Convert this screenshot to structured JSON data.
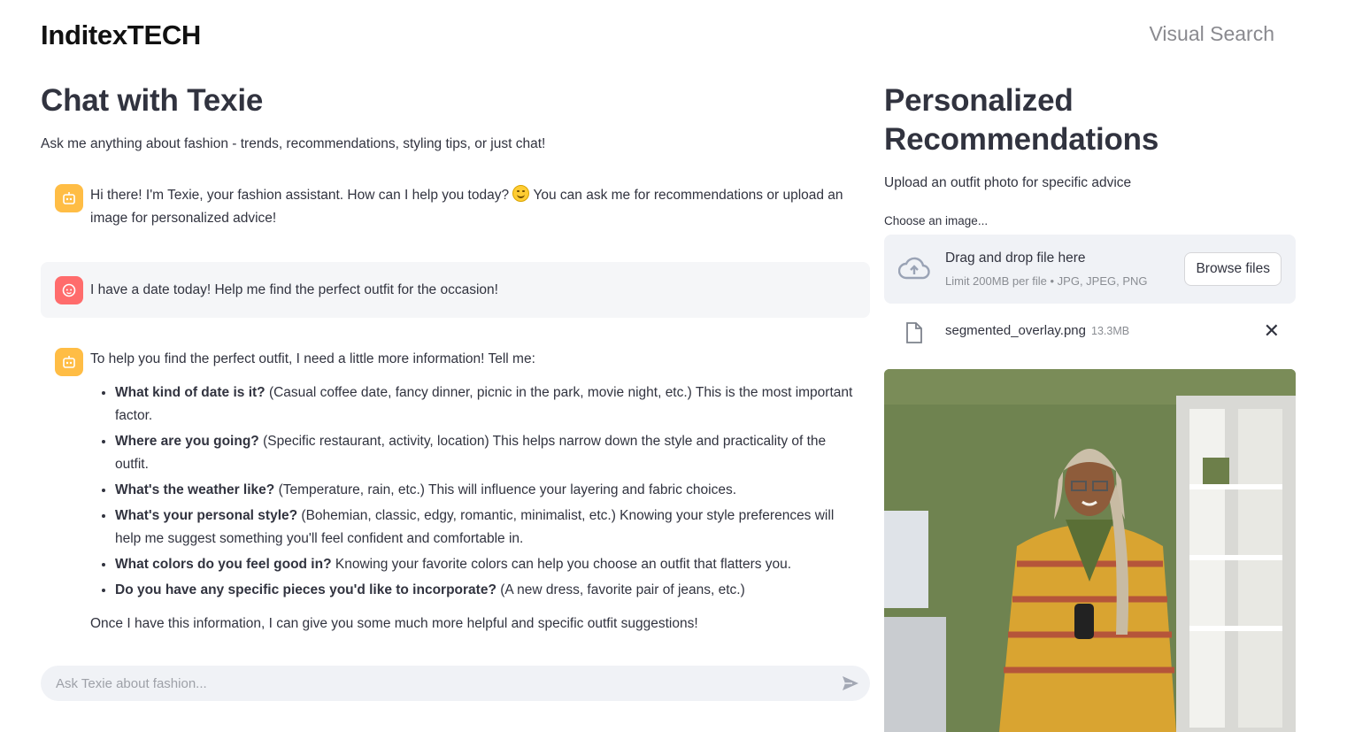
{
  "header": {
    "brand": "InditexTECH",
    "nav_link": "Visual Search"
  },
  "chat": {
    "title": "Chat with Texie",
    "subtitle": "Ask me anything about fashion - trends, recommendations, styling tips, or just chat!",
    "greeting_part1": "Hi there! I'm Texie, your fashion assistant. How can I help you today?",
    "greeting_part2": "You can ask me for recommendations or upload an image for personalized advice!",
    "user_message": "I have a date today! Help me find the perfect outfit for the occasion!",
    "reply_intro": "To help you find the perfect outfit, I need a little more information! Tell me:",
    "reply_items": [
      {
        "bold": "What kind of date is it?",
        "text": " (Casual coffee date, fancy dinner, picnic in the park, movie night, etc.) This is the most important factor."
      },
      {
        "bold": "Where are you going?",
        "text": " (Specific restaurant, activity, location) This helps narrow down the style and practicality of the outfit."
      },
      {
        "bold": "What's the weather like?",
        "text": " (Temperature, rain, etc.) This will influence your layering and fabric choices."
      },
      {
        "bold": "What's your personal style?",
        "text": " (Bohemian, classic, edgy, romantic, minimalist, etc.) Knowing your style preferences will help me suggest something you'll feel confident and comfortable in."
      },
      {
        "bold": "What colors do you feel good in?",
        "text": " Knowing your favorite colors can help you choose an outfit that flatters you."
      },
      {
        "bold": "Do you have any specific pieces you'd like to incorporate?",
        "text": " (A new dress, favorite pair of jeans, etc.)"
      }
    ],
    "reply_outro": "Once I have this information, I can give you some much more helpful and specific outfit suggestions!",
    "input_placeholder": "Ask Texie about fashion..."
  },
  "recommendations": {
    "title": "Personalized Recommendations",
    "subtitle": "Upload an outfit photo for specific advice",
    "uploader_label": "Choose an image...",
    "dropzone_title": "Drag and drop file here",
    "dropzone_limit": "Limit 200MB per file • JPG, JPEG, PNG",
    "browse_label": "Browse files",
    "file_name": "segmented_overlay.png",
    "file_size": "13.3MB"
  },
  "colors": {
    "bot_avatar": "#ffbd45",
    "user_avatar": "#ff6c6c",
    "photo_wall": "#6f8350"
  },
  "icons": [
    "bot-avatar-icon",
    "user-avatar-icon",
    "send-icon",
    "cloud-upload-icon",
    "file-icon",
    "close-icon",
    "smiling-emoji-icon"
  ]
}
